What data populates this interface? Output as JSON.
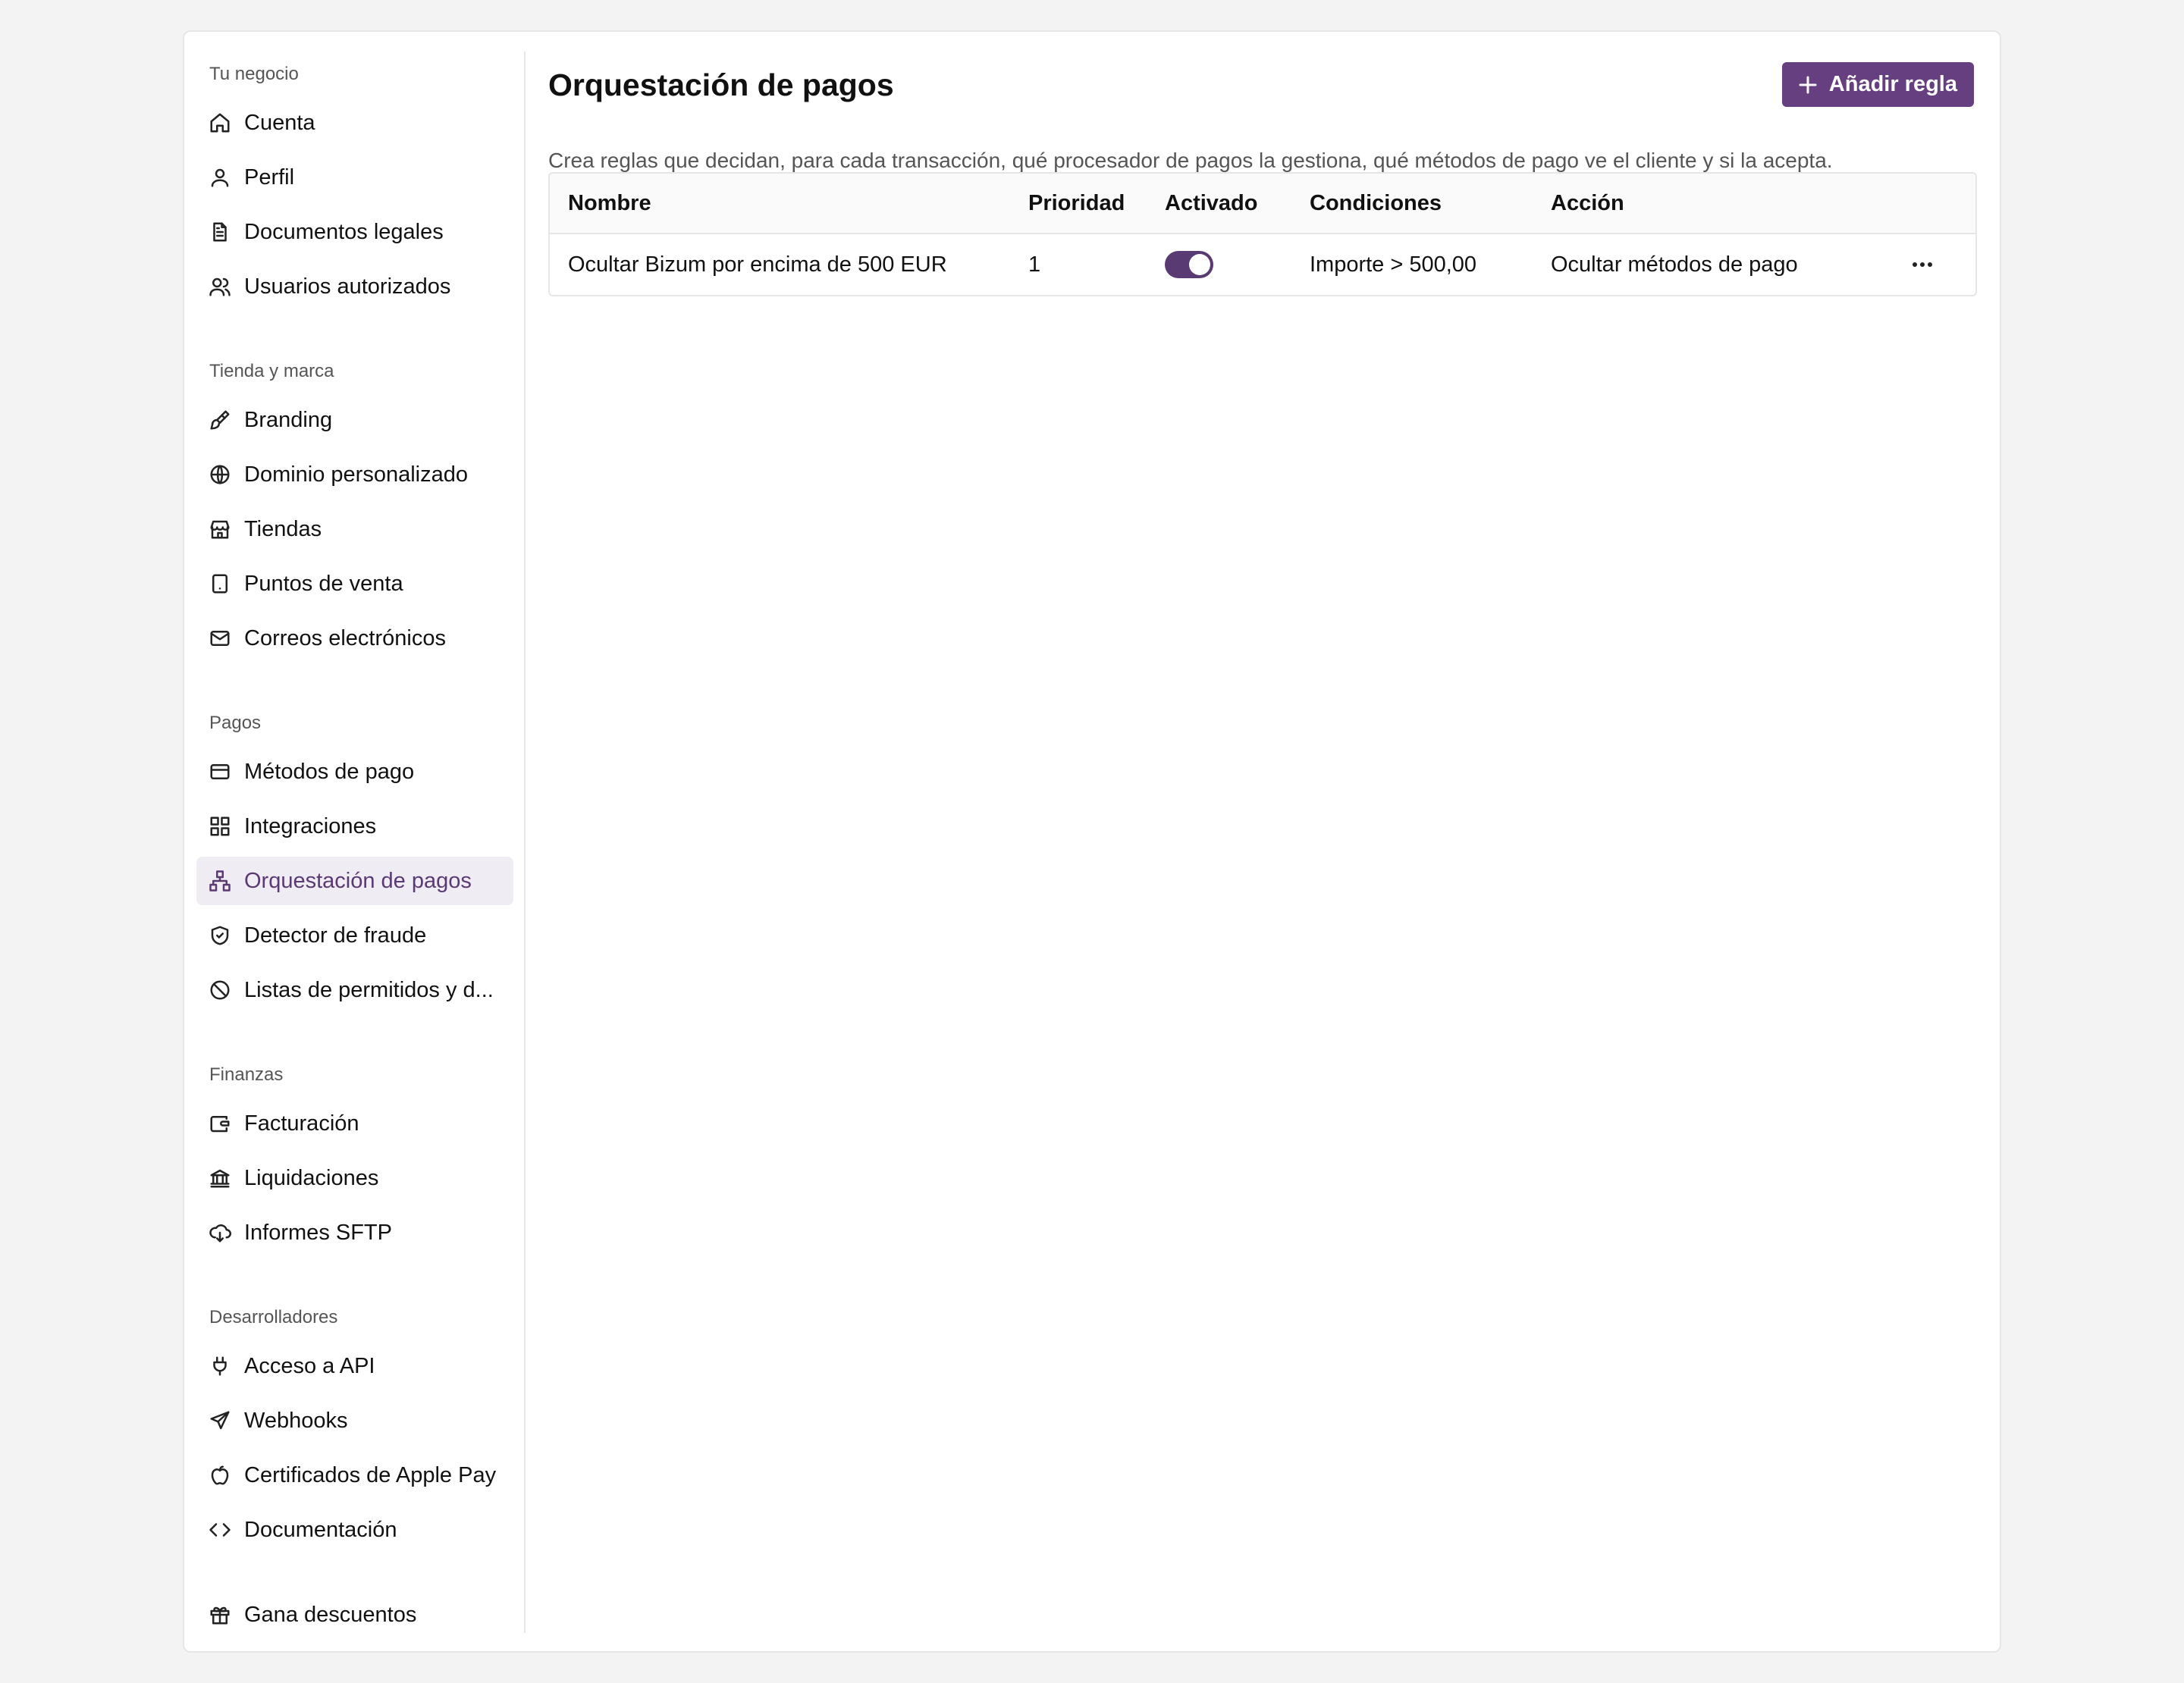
{
  "sidebar": {
    "sections": [
      {
        "label": "Tu negocio",
        "items": [
          {
            "label": "Cuenta",
            "icon": "home-icon"
          },
          {
            "label": "Perfil",
            "icon": "user-icon"
          },
          {
            "label": "Documentos legales",
            "icon": "document-icon"
          },
          {
            "label": "Usuarios autorizados",
            "icon": "users-icon"
          }
        ]
      },
      {
        "label": "Tienda y marca",
        "items": [
          {
            "label": "Branding",
            "icon": "paintbrush-icon"
          },
          {
            "label": "Dominio personalizado",
            "icon": "globe-icon"
          },
          {
            "label": "Tiendas",
            "icon": "store-icon"
          },
          {
            "label": "Puntos de venta",
            "icon": "tablet-icon"
          },
          {
            "label": "Correos electrónicos",
            "icon": "mail-icon"
          }
        ]
      },
      {
        "label": "Pagos",
        "items": [
          {
            "label": "Métodos de pago",
            "icon": "credit-card-icon"
          },
          {
            "label": "Integraciones",
            "icon": "grid-icon"
          },
          {
            "label": "Orquestación de pagos",
            "icon": "network-icon",
            "active": true
          },
          {
            "label": "Detector de fraude",
            "icon": "shield-check-icon"
          },
          {
            "label": "Listas de permitidos y d...",
            "icon": "ban-icon"
          }
        ]
      },
      {
        "label": "Finanzas",
        "items": [
          {
            "label": "Facturación",
            "icon": "wallet-icon"
          },
          {
            "label": "Liquidaciones",
            "icon": "bank-icon"
          },
          {
            "label": "Informes SFTP",
            "icon": "cloud-download-icon"
          }
        ]
      },
      {
        "label": "Desarrolladores",
        "items": [
          {
            "label": "Acceso a API",
            "icon": "plug-icon"
          },
          {
            "label": "Webhooks",
            "icon": "send-icon"
          },
          {
            "label": "Certificados de Apple Pay",
            "icon": "apple-icon"
          },
          {
            "label": "Documentación",
            "icon": "code-icon"
          }
        ]
      }
    ],
    "footer_item": {
      "label": "Gana descuentos",
      "icon": "gift-icon"
    }
  },
  "main": {
    "title": "Orquestación de pagos",
    "description": "Crea reglas que decidan, para cada transacción, qué procesador de pagos la gestiona, qué métodos de pago ve el cliente y si la acepta.",
    "add_button_label": "Añadir regla",
    "table": {
      "headers": {
        "name": "Nombre",
        "priority": "Prioridad",
        "enabled": "Activado",
        "conditions": "Condiciones",
        "action": "Acción"
      },
      "rows": [
        {
          "name": "Ocultar Bizum por encima de 500 EUR",
          "priority": "1",
          "enabled": true,
          "conditions": "Importe > 500,00",
          "action": "Ocultar métodos de pago"
        }
      ]
    }
  },
  "colors": {
    "accent": "#653f7f",
    "active_bg": "#f0ecf3",
    "page_bg": "#f3f3f3"
  }
}
